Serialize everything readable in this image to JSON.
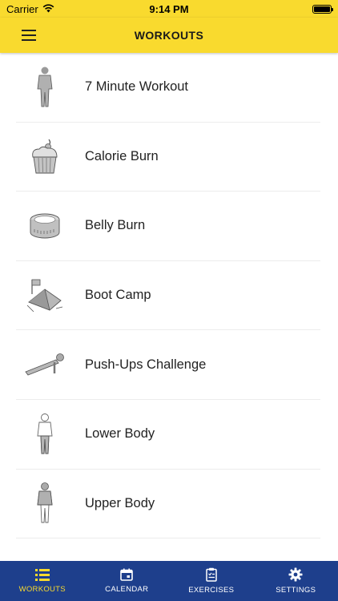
{
  "status": {
    "carrier": "Carrier",
    "time": "9:14 PM"
  },
  "header": {
    "title": "WORKOUTS"
  },
  "workouts": [
    {
      "label": "7 Minute Workout",
      "icon": "standing-person-icon"
    },
    {
      "label": "Calorie Burn",
      "icon": "cupcake-icon"
    },
    {
      "label": "Belly Burn",
      "icon": "measuring-tape-icon"
    },
    {
      "label": "Boot Camp",
      "icon": "tent-flag-icon"
    },
    {
      "label": "Push-Ups Challenge",
      "icon": "push-up-icon"
    },
    {
      "label": "Lower Body",
      "icon": "lower-body-icon"
    },
    {
      "label": "Upper Body",
      "icon": "upper-body-icon"
    }
  ],
  "tabs": [
    {
      "label": "WORKOUTS",
      "icon": "list-icon",
      "active": true
    },
    {
      "label": "CALENDAR",
      "icon": "calendar-icon",
      "active": false
    },
    {
      "label": "EXERCISES",
      "icon": "clipboard-icon",
      "active": false
    },
    {
      "label": "SETTINGS",
      "icon": "gear-icon",
      "active": false
    }
  ],
  "colors": {
    "accent": "#f9da2e",
    "tabbar": "#1e3f8c",
    "active_tab": "#f9da2e"
  }
}
